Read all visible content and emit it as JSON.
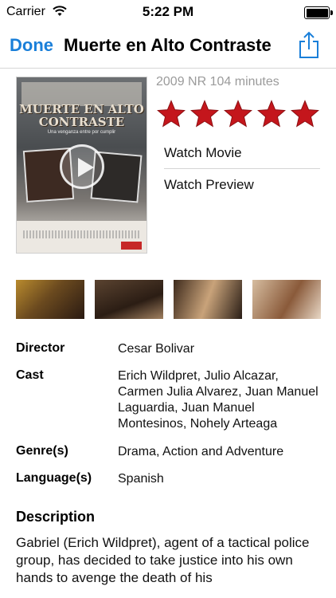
{
  "status_bar": {
    "carrier": "Carrier",
    "time": "5:22 PM",
    "battery_level": 1.0
  },
  "nav": {
    "done_label": "Done",
    "title": "Muerte en Alto Contraste",
    "share_icon": "share-icon"
  },
  "poster": {
    "title_line1": "MUERTE EN ALTO",
    "title_line2": "CONTRASTE",
    "tagline": "Una venganza entre por cumplir"
  },
  "movie": {
    "meta": "2009 NR 104 minutes",
    "rating_stars": 5,
    "rating_max": 5,
    "star_color": "#c4161c"
  },
  "actions": {
    "watch_movie": "Watch Movie",
    "watch_preview": "Watch Preview"
  },
  "details": {
    "director_label": "Director",
    "director": "Cesar Bolivar",
    "cast_label": "Cast",
    "cast": "Erich Wildpret, Julio Alcazar, Carmen Julia Alvarez, Juan Manuel Laguardia, Juan Manuel Montesinos, Nohely Arteaga",
    "genre_label": "Genre(s)",
    "genre": "Drama, Action and Adventure",
    "language_label": "Language(s)",
    "language": "Spanish"
  },
  "description": {
    "heading": "Description",
    "text": "Gabriel (Erich Wildpret), agent of a tactical police group, has decided to take justice into his own hands to avenge the death of his"
  },
  "colors": {
    "accent": "#1a7fd9"
  }
}
